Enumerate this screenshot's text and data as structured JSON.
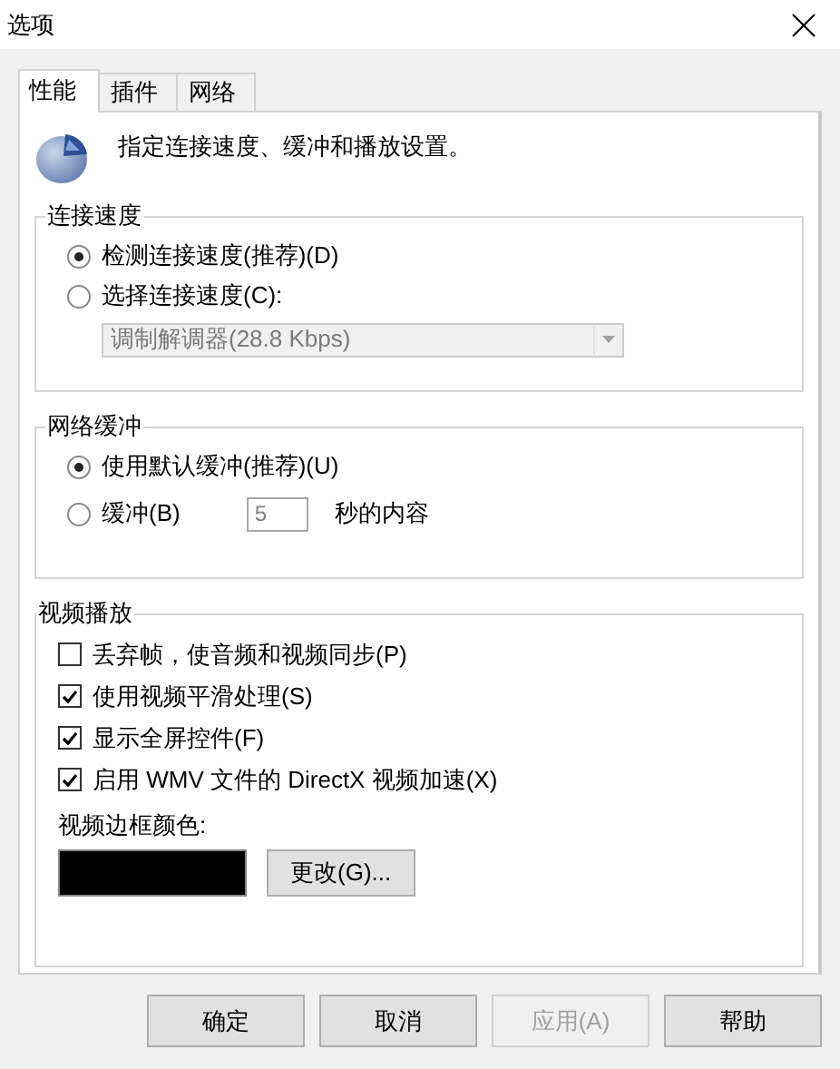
{
  "window": {
    "title": "选项"
  },
  "tabs": [
    {
      "label": "性能",
      "selected": true
    },
    {
      "label": "插件",
      "selected": false
    },
    {
      "label": "网络",
      "selected": false
    }
  ],
  "header": {
    "text": "指定连接速度、缓冲和播放设置。"
  },
  "groups": [
    {
      "title": "连接速度",
      "items": [
        {
          "kind": "radio",
          "label": "检测连接速度(推荐)(D)",
          "selected": true
        },
        {
          "kind": "radio",
          "label": "选择连接速度(C):",
          "selected": false
        },
        {
          "kind": "dropdown",
          "value": "调制解调器(28.8 Kbps)",
          "disabled": true
        }
      ]
    },
    {
      "title": "网络缓冲",
      "items": [
        {
          "kind": "radio",
          "label": "使用默认缓冲(推荐)(U)",
          "selected": true
        },
        {
          "kind": "radio-input",
          "label": "缓冲(B)",
          "selected": false,
          "value": "5",
          "suffix": "秒的内容",
          "disabled": true
        }
      ]
    },
    {
      "title": "视频播放",
      "items": [
        {
          "kind": "checkbox",
          "label": "丢弃帧，使音频和视频同步(P)",
          "checked": false
        },
        {
          "kind": "checkbox",
          "label": "使用视频平滑处理(S)",
          "checked": true
        },
        {
          "kind": "checkbox",
          "label": "显示全屏控件(F)",
          "checked": true
        },
        {
          "kind": "checkbox",
          "label": "启用 WMV 文件的 DirectX 视频加速(X)",
          "checked": true
        },
        {
          "kind": "label",
          "label": "视频边框颜色:"
        },
        {
          "kind": "color",
          "color": "#000000",
          "button": "更改(G)..."
        }
      ]
    }
  ],
  "buttons": [
    {
      "label": "确定",
      "disabled": false
    },
    {
      "label": "取消",
      "disabled": false
    },
    {
      "label": "应用(A)",
      "disabled": true
    },
    {
      "label": "帮助",
      "disabled": false
    }
  ]
}
